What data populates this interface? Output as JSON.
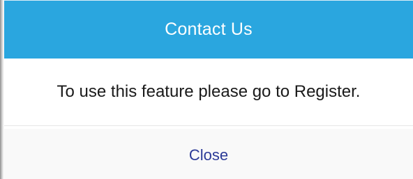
{
  "dialog": {
    "title": "Contact Us",
    "message": "To use this feature please go to Register.",
    "close_label": "Close"
  },
  "colors": {
    "header_background": "#2aa6df",
    "header_text": "#ffffff",
    "message_text": "#1a1a1a",
    "close_text": "#2c3b98"
  }
}
